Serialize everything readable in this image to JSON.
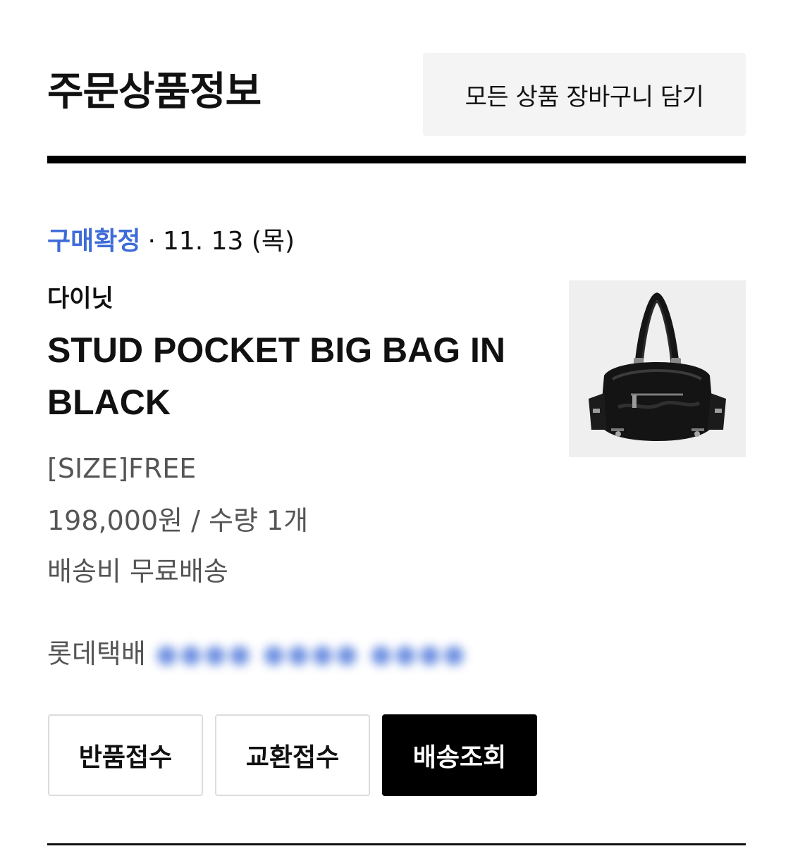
{
  "header": {
    "title": "주문상품정보",
    "add_all_to_cart_label": "모든 상품 장바구니 담기"
  },
  "order_item": {
    "status": {
      "label": "구매확정",
      "separator": "·",
      "date": "11. 13 (목)",
      "label_color": "#3d6bd8"
    },
    "brand": "다이닛",
    "product_name": "STUD POCKET BIG BAG IN BLACK",
    "option": "[SIZE]FREE",
    "price_quantity": "198,000원 / 수량 1개",
    "shipping_fee": "배송비 무료배송",
    "courier": "롯데택배",
    "image_icon": "black-leather-bag-icon"
  },
  "actions": {
    "return_label": "반품접수",
    "exchange_label": "교환접수",
    "track_label": "배송조회"
  }
}
